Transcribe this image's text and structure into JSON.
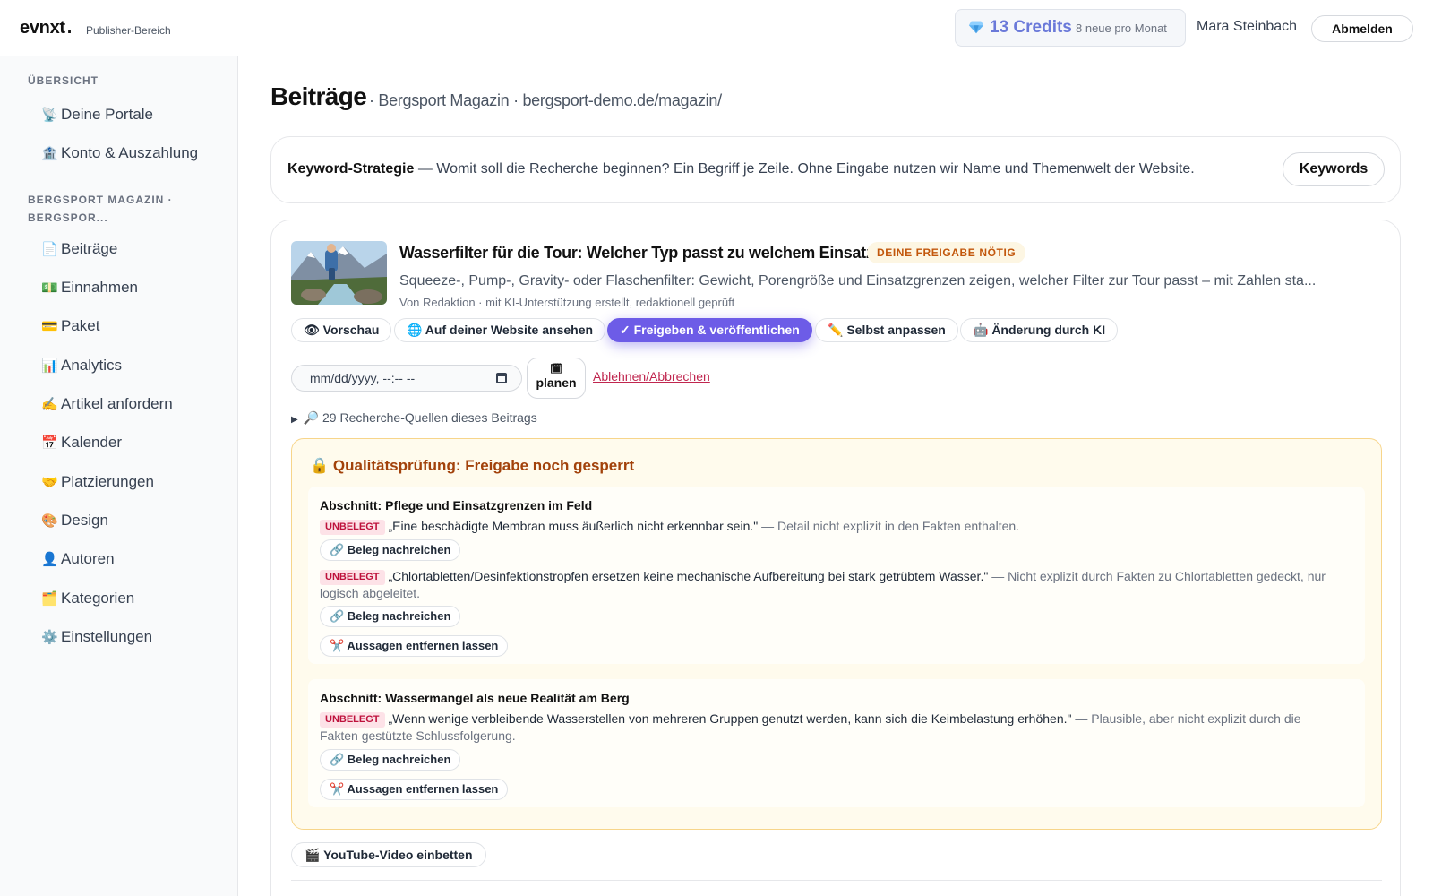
{
  "header": {
    "logo": "evnxt",
    "logo_dot": ".",
    "logo_sub": "Publisher-Bereich",
    "credits_value": "13 Credits",
    "credits_sub": "8 neue pro Monat",
    "user_name": "Mara Steinbach",
    "logout_label": "Abmelden"
  },
  "sidebar": {
    "section1_heading": "ÜBERSICHT",
    "section1_items": [
      {
        "icon": "📡",
        "label": "Deine Portale"
      },
      {
        "icon": "🏦",
        "label": "Konto & Auszahlung"
      }
    ],
    "section2_heading_line1": "BERGSPORT MAGAZIN ·",
    "section2_heading_line2": "BERGSPOR...",
    "section2_items": [
      {
        "icon": "📄",
        "label": "Beiträge"
      },
      {
        "icon": "💵",
        "label": "Einnahmen"
      },
      {
        "icon": "💳",
        "label": "Paket"
      },
      {
        "icon": "📊",
        "label": "Analytics"
      },
      {
        "icon": "✍️",
        "label": "Artikel anfordern"
      },
      {
        "icon": "📅",
        "label": "Kalender"
      },
      {
        "icon": "🤝",
        "label": "Platzierungen"
      },
      {
        "icon": "🎨",
        "label": "Design"
      },
      {
        "icon": "👤",
        "label": "Autoren"
      },
      {
        "icon": "🗂️",
        "label": "Kategorien"
      },
      {
        "icon": "⚙️",
        "label": "Einstellungen"
      }
    ]
  },
  "main": {
    "title": "Beiträge",
    "subtitle": "· Bergsport Magazin · bergsport-demo.de/magazin/",
    "keyword": {
      "label": "Keyword-Strategie",
      "text": " — Womit soll die Recherche beginnen? Ein Begriff je Zeile. Ohne Eingabe nutzen wir Name und Themenwelt der Website.",
      "button": "Keywords"
    },
    "post": {
      "title": "Wasserfilter für die Tour: Welcher Typ passt zu welchem Einsatz?",
      "badge": "DEINE FREIGABE NÖTIG",
      "excerpt": "Squeeze-, Pump-, Gravity- oder Flaschenfilter: Gewicht, Porengröße und Einsatzgrenzen zeigen, welcher Filter zur Tour passt – mit Zahlen sta...",
      "meta": "Von Redaktion · mit KI-Unterstützung erstellt, redaktionell geprüft",
      "actions": {
        "preview": "👁 Vorschau",
        "website": "🌐 Auf deiner Website ansehen",
        "publish": "✓ Freigeben & veröffentlichen",
        "edit": "✏️ Selbst anpassen",
        "ai_change": "🤖 Änderung durch KI"
      },
      "date_placeholder": "mm/dd/yyyy, --:-- --",
      "plan_icon": "🗓",
      "plan_label": "planen",
      "reject_label": "Ablehnen/Abbrechen",
      "sources_label": "🔎 29 Recherche-Quellen dieses Beitrags",
      "qa": {
        "title": "🔒 Qualitätsprüfung: Freigabe noch gesperrt",
        "sections": [
          {
            "title": "Abschnitt: Pflege und Einsatzgrenzen im Feld",
            "claims": [
              {
                "tag": "UNBELEGT",
                "quote": "„Eine beschädigte Membran muss äußerlich nicht erkennbar sein.\"",
                "reason": " — Detail nicht explizit in den Fakten enthalten."
              },
              {
                "tag": "UNBELEGT",
                "quote": "„Chlortabletten/Desinfektionstropfen ersetzen keine mechanische Aufbereitung bei stark getrübtem Wasser.\"",
                "reason": " — Nicht explizit durch Fakten zu Chlortabletten gedeckt, nur logisch abgeleitet."
              }
            ],
            "evidence_label": "🔗 Beleg nachreichen",
            "remove_label": "✂️ Aussagen entfernen lassen"
          },
          {
            "title": "Abschnitt: Wassermangel als neue Realität am Berg",
            "claims": [
              {
                "tag": "UNBELEGT",
                "quote": "„Wenn wenige verbleibende Wasserstellen von mehreren Gruppen genutzt werden, kann sich die Keimbelastung erhöhen.\"",
                "reason": " — Plausible, aber nicht explizit durch die Fakten gestützte Schlussfolgerung."
              }
            ],
            "evidence_label": "🔗 Beleg nachreichen",
            "remove_label": "✂️ Aussagen entfernen lassen"
          }
        ]
      },
      "youtube_label": "🎬 YouTube-Video einbetten"
    }
  },
  "colors": {
    "accent": "#6d5ce7",
    "credits": "#6a79d9",
    "warning_border": "#f7d58a",
    "warning_bg": "#fffbed",
    "unverified_tag": "#be123c"
  }
}
